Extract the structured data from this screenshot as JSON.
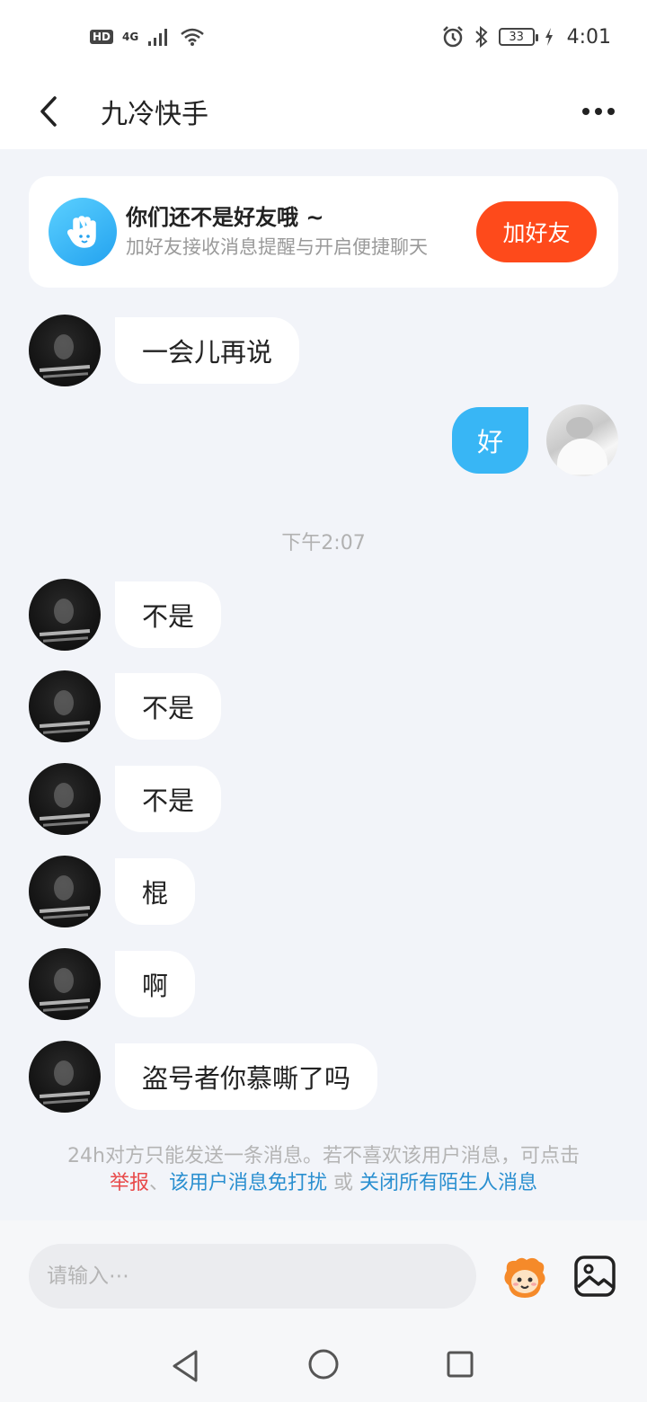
{
  "status_bar": {
    "hd": "HD",
    "network": "4G",
    "battery": "33",
    "time": "4:01"
  },
  "header": {
    "title": "九冷快手"
  },
  "friend_card": {
    "title": "你们还不是好友哦 ~",
    "subtitle": "加好友接收消息提醒与开启便捷聊天",
    "button": "加好友"
  },
  "messages": {
    "m1": "一会儿再说",
    "self1": "好",
    "timestamp": "下午2:07",
    "m2": "不是",
    "m3": "不是",
    "m4": "不是",
    "m5": "棍",
    "m6": "啊",
    "m7": "盗号者你慕嘶了吗"
  },
  "notice": {
    "text": "24h对方只能发送一条消息。若不喜欢该用户消息，可点击",
    "report": "举报",
    "sep1": "、",
    "mute": "该用户消息免打扰",
    "or": " 或 ",
    "close_all": "关闭所有陌生人消息"
  },
  "input": {
    "placeholder": "请输入⋯"
  }
}
